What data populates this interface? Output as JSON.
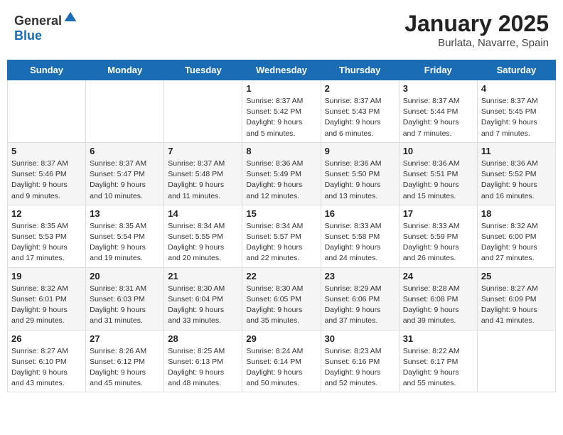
{
  "header": {
    "logo_general": "General",
    "logo_blue": "Blue",
    "month_title": "January 2025",
    "location": "Burlata, Navarre, Spain"
  },
  "weekdays": [
    "Sunday",
    "Monday",
    "Tuesday",
    "Wednesday",
    "Thursday",
    "Friday",
    "Saturday"
  ],
  "weeks": [
    [
      {
        "day": "",
        "sunrise": "",
        "sunset": "",
        "daylight": ""
      },
      {
        "day": "",
        "sunrise": "",
        "sunset": "",
        "daylight": ""
      },
      {
        "day": "",
        "sunrise": "",
        "sunset": "",
        "daylight": ""
      },
      {
        "day": "1",
        "sunrise": "Sunrise: 8:37 AM",
        "sunset": "Sunset: 5:42 PM",
        "daylight": "Daylight: 9 hours and 5 minutes."
      },
      {
        "day": "2",
        "sunrise": "Sunrise: 8:37 AM",
        "sunset": "Sunset: 5:43 PM",
        "daylight": "Daylight: 9 hours and 6 minutes."
      },
      {
        "day": "3",
        "sunrise": "Sunrise: 8:37 AM",
        "sunset": "Sunset: 5:44 PM",
        "daylight": "Daylight: 9 hours and 7 minutes."
      },
      {
        "day": "4",
        "sunrise": "Sunrise: 8:37 AM",
        "sunset": "Sunset: 5:45 PM",
        "daylight": "Daylight: 9 hours and 7 minutes."
      }
    ],
    [
      {
        "day": "5",
        "sunrise": "Sunrise: 8:37 AM",
        "sunset": "Sunset: 5:46 PM",
        "daylight": "Daylight: 9 hours and 9 minutes."
      },
      {
        "day": "6",
        "sunrise": "Sunrise: 8:37 AM",
        "sunset": "Sunset: 5:47 PM",
        "daylight": "Daylight: 9 hours and 10 minutes."
      },
      {
        "day": "7",
        "sunrise": "Sunrise: 8:37 AM",
        "sunset": "Sunset: 5:48 PM",
        "daylight": "Daylight: 9 hours and 11 minutes."
      },
      {
        "day": "8",
        "sunrise": "Sunrise: 8:36 AM",
        "sunset": "Sunset: 5:49 PM",
        "daylight": "Daylight: 9 hours and 12 minutes."
      },
      {
        "day": "9",
        "sunrise": "Sunrise: 8:36 AM",
        "sunset": "Sunset: 5:50 PM",
        "daylight": "Daylight: 9 hours and 13 minutes."
      },
      {
        "day": "10",
        "sunrise": "Sunrise: 8:36 AM",
        "sunset": "Sunset: 5:51 PM",
        "daylight": "Daylight: 9 hours and 15 minutes."
      },
      {
        "day": "11",
        "sunrise": "Sunrise: 8:36 AM",
        "sunset": "Sunset: 5:52 PM",
        "daylight": "Daylight: 9 hours and 16 minutes."
      }
    ],
    [
      {
        "day": "12",
        "sunrise": "Sunrise: 8:35 AM",
        "sunset": "Sunset: 5:53 PM",
        "daylight": "Daylight: 9 hours and 17 minutes."
      },
      {
        "day": "13",
        "sunrise": "Sunrise: 8:35 AM",
        "sunset": "Sunset: 5:54 PM",
        "daylight": "Daylight: 9 hours and 19 minutes."
      },
      {
        "day": "14",
        "sunrise": "Sunrise: 8:34 AM",
        "sunset": "Sunset: 5:55 PM",
        "daylight": "Daylight: 9 hours and 20 minutes."
      },
      {
        "day": "15",
        "sunrise": "Sunrise: 8:34 AM",
        "sunset": "Sunset: 5:57 PM",
        "daylight": "Daylight: 9 hours and 22 minutes."
      },
      {
        "day": "16",
        "sunrise": "Sunrise: 8:33 AM",
        "sunset": "Sunset: 5:58 PM",
        "daylight": "Daylight: 9 hours and 24 minutes."
      },
      {
        "day": "17",
        "sunrise": "Sunrise: 8:33 AM",
        "sunset": "Sunset: 5:59 PM",
        "daylight": "Daylight: 9 hours and 26 minutes."
      },
      {
        "day": "18",
        "sunrise": "Sunrise: 8:32 AM",
        "sunset": "Sunset: 6:00 PM",
        "daylight": "Daylight: 9 hours and 27 minutes."
      }
    ],
    [
      {
        "day": "19",
        "sunrise": "Sunrise: 8:32 AM",
        "sunset": "Sunset: 6:01 PM",
        "daylight": "Daylight: 9 hours and 29 minutes."
      },
      {
        "day": "20",
        "sunrise": "Sunrise: 8:31 AM",
        "sunset": "Sunset: 6:03 PM",
        "daylight": "Daylight: 9 hours and 31 minutes."
      },
      {
        "day": "21",
        "sunrise": "Sunrise: 8:30 AM",
        "sunset": "Sunset: 6:04 PM",
        "daylight": "Daylight: 9 hours and 33 minutes."
      },
      {
        "day": "22",
        "sunrise": "Sunrise: 8:30 AM",
        "sunset": "Sunset: 6:05 PM",
        "daylight": "Daylight: 9 hours and 35 minutes."
      },
      {
        "day": "23",
        "sunrise": "Sunrise: 8:29 AM",
        "sunset": "Sunset: 6:06 PM",
        "daylight": "Daylight: 9 hours and 37 minutes."
      },
      {
        "day": "24",
        "sunrise": "Sunrise: 8:28 AM",
        "sunset": "Sunset: 6:08 PM",
        "daylight": "Daylight: 9 hours and 39 minutes."
      },
      {
        "day": "25",
        "sunrise": "Sunrise: 8:27 AM",
        "sunset": "Sunset: 6:09 PM",
        "daylight": "Daylight: 9 hours and 41 minutes."
      }
    ],
    [
      {
        "day": "26",
        "sunrise": "Sunrise: 8:27 AM",
        "sunset": "Sunset: 6:10 PM",
        "daylight": "Daylight: 9 hours and 43 minutes."
      },
      {
        "day": "27",
        "sunrise": "Sunrise: 8:26 AM",
        "sunset": "Sunset: 6:12 PM",
        "daylight": "Daylight: 9 hours and 45 minutes."
      },
      {
        "day": "28",
        "sunrise": "Sunrise: 8:25 AM",
        "sunset": "Sunset: 6:13 PM",
        "daylight": "Daylight: 9 hours and 48 minutes."
      },
      {
        "day": "29",
        "sunrise": "Sunrise: 8:24 AM",
        "sunset": "Sunset: 6:14 PM",
        "daylight": "Daylight: 9 hours and 50 minutes."
      },
      {
        "day": "30",
        "sunrise": "Sunrise: 8:23 AM",
        "sunset": "Sunset: 6:16 PM",
        "daylight": "Daylight: 9 hours and 52 minutes."
      },
      {
        "day": "31",
        "sunrise": "Sunrise: 8:22 AM",
        "sunset": "Sunset: 6:17 PM",
        "daylight": "Daylight: 9 hours and 55 minutes."
      },
      {
        "day": "",
        "sunrise": "",
        "sunset": "",
        "daylight": ""
      }
    ]
  ]
}
